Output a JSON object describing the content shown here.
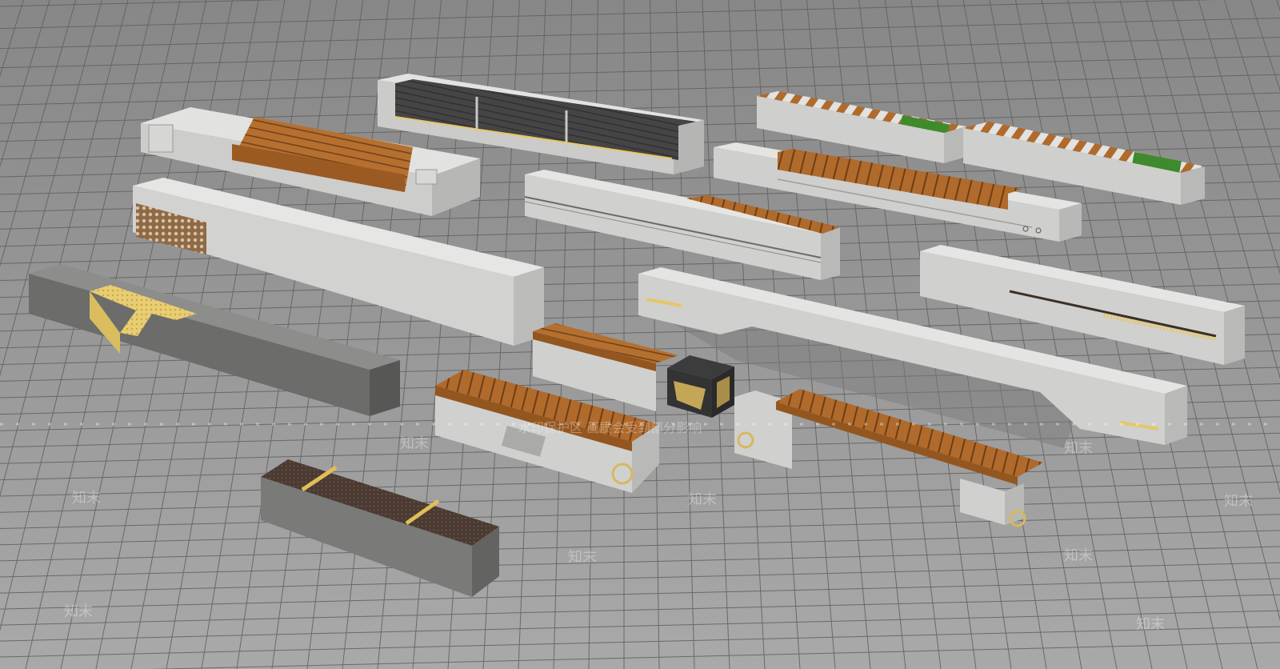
{
  "watermark": {
    "banner": "水印保护区   画质会受到部分影响",
    "mark": "知末"
  },
  "palette": {
    "ground_top": "#8a8a8a",
    "ground_bottom": "#a8a8a8",
    "grid_line": "#5e5e5e",
    "marble_top": "#e6e6e4",
    "marble_front": "#cfcfcd",
    "marble_side": "#b9b9b7",
    "dark_granite_top": "#8a8a88",
    "dark_granite_front": "#6b6b69",
    "wood": "#b06a2c",
    "wood_dark": "#7d4718",
    "dark_panel": "#3e3e3e",
    "gold": "#e6c766",
    "grass": "#3f8a2c"
  },
  "objects": [
    "bench-dark-slats-three-panels",
    "bench-marble-wood-backrest",
    "bench-diagonal-wood-grass-1",
    "bench-diagonal-wood-grass-2",
    "bench-marble-wood-slat-rail",
    "bench-marble-long-block-mesh",
    "bench-marble-rail-wood-inset",
    "bench-marble-led-slot",
    "bench-marble-long-curved",
    "bench-dark-granite-gold-inlay",
    "bench-short-wood-top",
    "planter-cube-dark-gold",
    "bench-wood-top-marble-base",
    "bench-wood-floating-marble-legs",
    "bench-dark-top-gold-bands"
  ]
}
